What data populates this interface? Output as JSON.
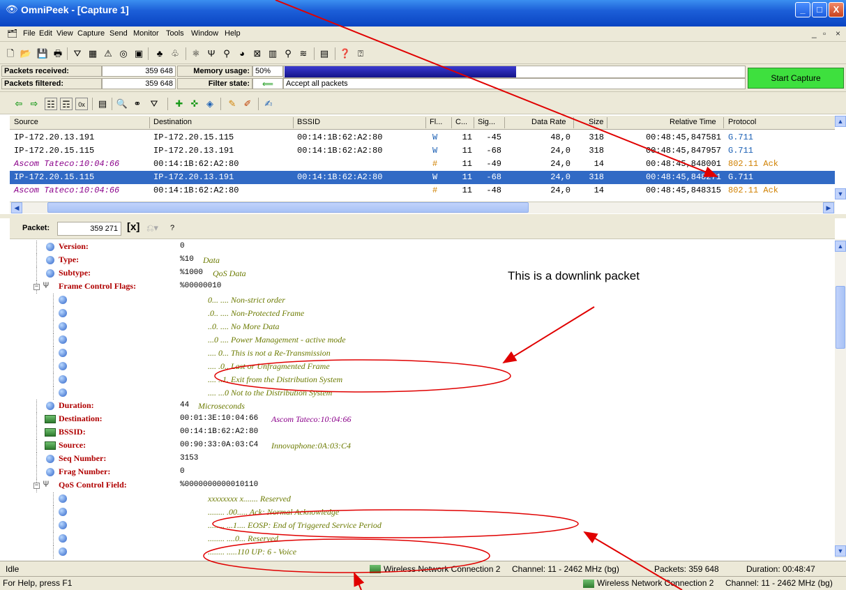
{
  "window": {
    "title": "OmniPeek - [Capture 1]",
    "min_label": "_",
    "max_label": "□",
    "close_label": "X"
  },
  "menu": {
    "items": [
      "File",
      "Edit",
      "View",
      "Capture",
      "Send",
      "Monitor",
      "Tools",
      "Window",
      "Help"
    ],
    "mdi_min": "_",
    "mdi_restore": "▫",
    "mdi_close": "×"
  },
  "stats": {
    "packets_received_label": "Packets received:",
    "packets_received_value": "359 648",
    "packets_filtered_label": "Packets filtered:",
    "packets_filtered_value": "359 648",
    "memory_usage_label": "Memory usage:",
    "memory_usage_value": "50%",
    "memory_fraction": 0.5,
    "filter_state_label": "Filter state:",
    "filter_state_value": "Accept all packets",
    "start_capture_label": "Start Capture"
  },
  "packet_list": {
    "columns": [
      "Source",
      "Destination",
      "BSSID",
      "Fl...",
      "C...",
      "Sig...",
      "Data Rate",
      "Size",
      "Relative Time",
      "Protocol"
    ],
    "rows": [
      {
        "source": "IP-172.20.13.191",
        "destination": "IP-172.20.15.115",
        "bssid": "00:14:1B:62:A2:80",
        "flag": "W",
        "channel": "11",
        "signal": "-45",
        "rate": "48,0",
        "size": "318",
        "time": "00:48:45,847581",
        "protocol": "G.711",
        "selected": false,
        "source_italic": false
      },
      {
        "source": "IP-172.20.15.115",
        "destination": "IP-172.20.13.191",
        "bssid": "00:14:1B:62:A2:80",
        "flag": "W",
        "channel": "11",
        "signal": "-68",
        "rate": "24,0",
        "size": "318",
        "time": "00:48:45,847957",
        "protocol": "G.711",
        "selected": false,
        "source_italic": false
      },
      {
        "source": "Ascom Tateco:10:04:66",
        "destination": "00:14:1B:62:A2:80",
        "bssid": "",
        "flag": "#",
        "channel": "11",
        "signal": "-49",
        "rate": "24,0",
        "size": "14",
        "time": "00:48:45,848001",
        "protocol": "802.11 Ack",
        "selected": false,
        "source_italic": true
      },
      {
        "source": "IP-172.20.15.115",
        "destination": "IP-172.20.13.191",
        "bssid": "00:14:1B:62:A2:80",
        "flag": "W",
        "channel": "11",
        "signal": "-68",
        "rate": "24,0",
        "size": "318",
        "time": "00:48:45,848271",
        "protocol": "G.711",
        "selected": true,
        "source_italic": false
      },
      {
        "source": "Ascom Tateco:10:04:66",
        "destination": "00:14:1B:62:A2:80",
        "bssid": "",
        "flag": "#",
        "channel": "11",
        "signal": "-48",
        "rate": "24,0",
        "size": "14",
        "time": "00:48:45,848315",
        "protocol": "802.11 Ack",
        "selected": false,
        "source_italic": true
      }
    ]
  },
  "packet_detail": {
    "packet_label": "Packet:",
    "packet_number": "359 271",
    "help_label": "?",
    "rows": [
      {
        "kind": "node",
        "label": "Version:",
        "value": "0",
        "comment": ""
      },
      {
        "kind": "node",
        "label": "Type:",
        "value": "%10",
        "comment": "Data"
      },
      {
        "kind": "node",
        "label": "Subtype:",
        "value": "%1000",
        "comment": "QoS Data"
      },
      {
        "kind": "fork",
        "label": "Frame Control Flags:",
        "value": "%00000010",
        "comment": ""
      },
      {
        "kind": "sub",
        "text": "0... .... Non-strict order"
      },
      {
        "kind": "sub",
        "text": ".0.. .... Non-Protected Frame"
      },
      {
        "kind": "sub",
        "text": "..0. .... No More Data"
      },
      {
        "kind": "sub",
        "text": "...0 .... Power Management - active mode"
      },
      {
        "kind": "sub",
        "text": ".... 0... This is not a Re-Transmission"
      },
      {
        "kind": "sub",
        "text": ".... .0.. Last or Unfragmented Frame"
      },
      {
        "kind": "sub",
        "text": ".... ..1. Exit from the Distribution System"
      },
      {
        "kind": "sub",
        "text": ".... ...0 Not to the Distribution System"
      },
      {
        "kind": "node",
        "label": "Duration:",
        "value": "44",
        "comment": "Microseconds"
      },
      {
        "kind": "sq",
        "label": "Destination:",
        "value": "00:01:3E:10:04:66",
        "comment": "Ascom Tateco:10:04:66"
      },
      {
        "kind": "sq",
        "label": "BSSID:",
        "value": "00:14:1B:62:A2:80",
        "comment": ""
      },
      {
        "kind": "sq",
        "label": "Source:",
        "value": "00:90:33:0A:03:C4",
        "comment": "Innovaphone:0A:03:C4"
      },
      {
        "kind": "node",
        "label": "Seq Number:",
        "value": "3153",
        "comment": ""
      },
      {
        "kind": "node",
        "label": "Frag Number:",
        "value": "0",
        "comment": ""
      },
      {
        "kind": "fork",
        "label": "QoS Control Field:",
        "value": "%0000000000010110",
        "comment": ""
      },
      {
        "kind": "sub",
        "text": "xxxxxxxx x....... Reserved"
      },
      {
        "kind": "sub",
        "text": "........ .00..... Ack: Normal Acknowledge"
      },
      {
        "kind": "sub",
        "text": "........ ...1.... EOSP: End of Triggered Service Period"
      },
      {
        "kind": "sub",
        "text": "........ ....0... Reserved"
      },
      {
        "kind": "sub",
        "text": "........ .....110 UP: 6 - Voice"
      }
    ]
  },
  "status": {
    "idle": "Idle",
    "help": "For Help, press F1",
    "adapter": "Wireless Network Connection 2",
    "channel": "Channel: 11 - 2462 MHz (bg)",
    "packets": "Packets:  359 648",
    "duration": "Duration:  00:48:47"
  },
  "annotations": {
    "downlink_note": "This is a downlink packet"
  },
  "colors": {
    "annotation": "#e00000",
    "selection": "#316ac5",
    "protocol_g711": "#1a5fb4",
    "protocol_ack": "#d08000",
    "ascom": "#8a008a",
    "detail_label": "#b00000",
    "detail_comment": "#6b7a00"
  }
}
